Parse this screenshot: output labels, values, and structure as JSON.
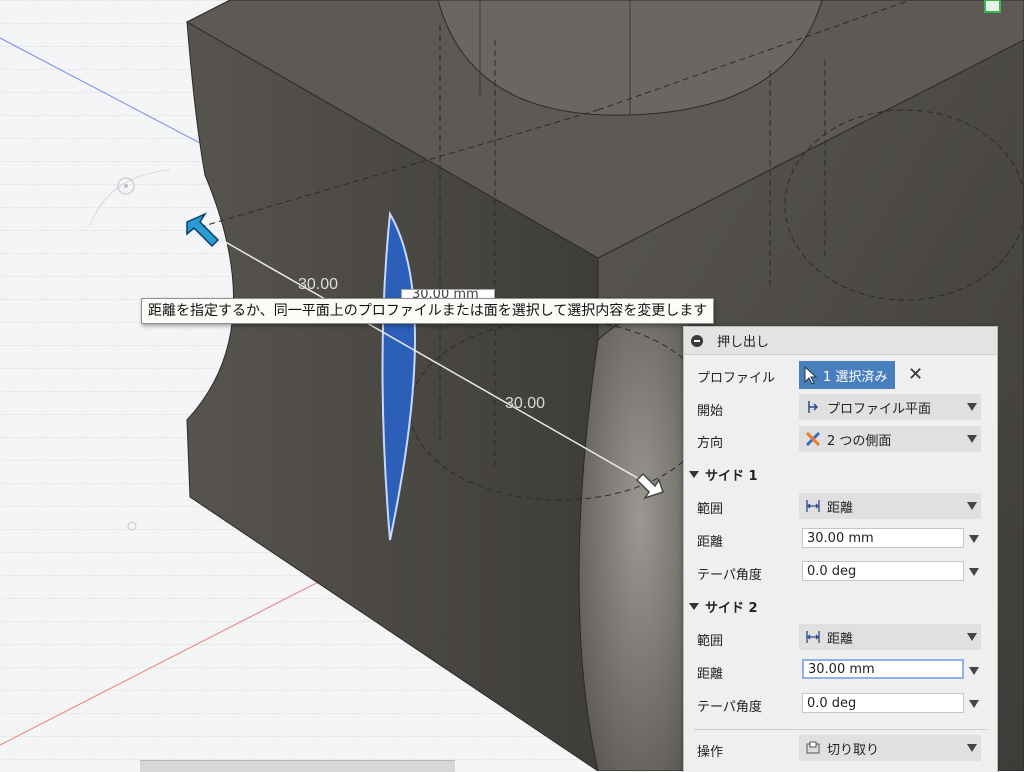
{
  "tooltip": "距離を指定するか、同一平面上のプロファイルまたは面を選択して選択内容を変更します",
  "dim_input_text": "30.00 mm",
  "dim_labels": {
    "left": "30.00",
    "right": "30.00"
  },
  "dialog": {
    "title": "押し出し",
    "profile_label": "プロファイル",
    "profile_button": "1 選択済み",
    "clear_symbol": "✕",
    "start_label": "開始",
    "start_value": "プロファイル平面",
    "direction_label": "方向",
    "direction_value": "2 つの側面",
    "side1": {
      "title": "サイド 1",
      "extent_label": "範囲",
      "extent_value": "距離",
      "distance_label": "距離",
      "distance_value": "30.00 mm",
      "taper_label": "テーパ角度",
      "taper_value": "0.0 deg"
    },
    "side2": {
      "title": "サイド 2",
      "extent_label": "範囲",
      "extent_value": "距離",
      "distance_label": "距離",
      "distance_value": "30.00 mm",
      "taper_label": "テーパ角度",
      "taper_value": "0.0 deg"
    },
    "operation_label": "操作",
    "operation_value": "切り取り"
  },
  "colors": {
    "accent": "#4a7fbd",
    "profile_fill": "#2c5fb8",
    "body_dark": "#4d4a45",
    "body_top": "#5f5c57",
    "background": "#f4f5f6"
  }
}
